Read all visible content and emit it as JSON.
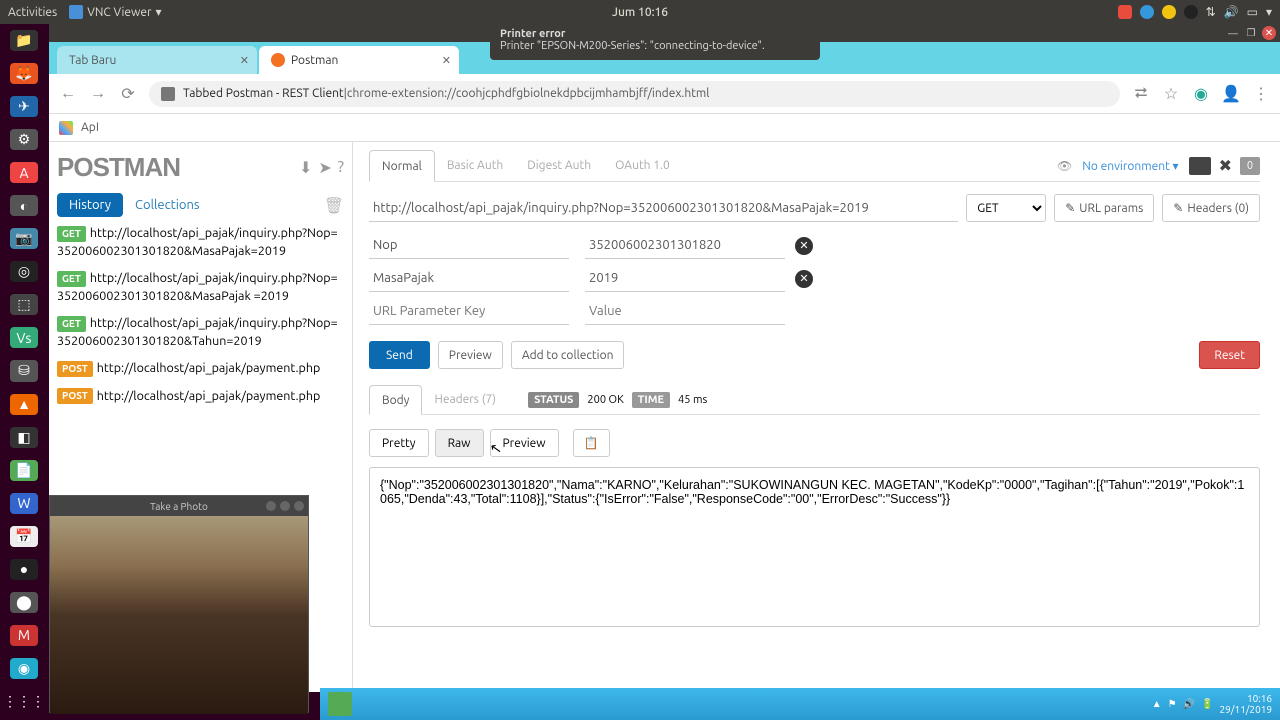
{
  "topbar": {
    "activities": "Activities",
    "app": "VNC Viewer",
    "clock": "Jum 10:16"
  },
  "notification": {
    "title": "Printer error",
    "body": "Printer \"EPSON-M200-Series\": \"connecting-to-device\"."
  },
  "browser": {
    "tabs": [
      {
        "label": "Tab Baru",
        "active": false
      },
      {
        "label": "Postman",
        "active": true
      }
    ],
    "url_prefix": "Tabbed Postman - REST Client",
    "url_sep": " | ",
    "url": "chrome-extension://coohjcphdfgbiolnekdpbcijmhambjff/index.html",
    "bookmark": "ApI"
  },
  "sidebar": {
    "logo": "POSTMAN",
    "tabs": {
      "history": "History",
      "collections": "Collections"
    },
    "history": [
      {
        "method": "GET",
        "url": "http://localhost/api_pajak/inquiry.php?Nop=352006002301301820&MasaPajak=2019"
      },
      {
        "method": "GET",
        "url": "http://localhost/api_pajak/inquiry.php?Nop=352006002301301820&MasaPajak =2019"
      },
      {
        "method": "GET",
        "url": "http://localhost/api_pajak/inquiry.php?Nop=352006002301301820&Tahun=2019"
      },
      {
        "method": "POST",
        "url": "http://localhost/api_pajak/payment.php"
      },
      {
        "method": "POST",
        "url": "http://localhost/api_pajak/payment.php"
      }
    ]
  },
  "request": {
    "auth_tabs": {
      "normal": "Normal",
      "basic": "Basic Auth",
      "digest": "Digest Auth",
      "oauth": "OAuth 1.0"
    },
    "env_label": "No environment",
    "env_badge": "0",
    "url": "http://localhost/api_pajak/inquiry.php?Nop=352006002301301820&MasaPajak=2019",
    "method": "GET",
    "url_params_btn": "URL params",
    "headers_btn": "Headers (0)",
    "params": [
      {
        "key": "Nop",
        "value": "352006002301301820"
      },
      {
        "key": "MasaPajak",
        "value": "2019"
      }
    ],
    "param_placeholder": {
      "key": "URL Parameter Key",
      "value": "Value"
    },
    "actions": {
      "send": "Send",
      "preview": "Preview",
      "add": "Add to collection",
      "reset": "Reset"
    }
  },
  "response": {
    "tabs": {
      "body": "Body",
      "headers": "Headers (7)"
    },
    "status_label": "STATUS",
    "status_value": "200 OK",
    "time_label": "TIME",
    "time_value": "45 ms",
    "view": {
      "pretty": "Pretty",
      "raw": "Raw",
      "preview": "Preview"
    },
    "body": "{\"Nop\":\"352006002301301820\",\"Nama\":\"KARNO\",\"Kelurahan\":\"SUKOWINANGUN KEC. MAGETAN\",\"KodeKp\":\"0000\",\"Tagihan\":[{\"Tahun\":\"2019\",\"Pokok\":1065,\"Denda\":43,\"Total\":1108}],\"Status\":{\"IsError\":\"False\",\"ResponseCode\":\"00\",\"ErrorDesc\":\"Success\"}}"
  },
  "webcam": {
    "title": "Take a Photo"
  },
  "taskbar": {
    "time": "10:16",
    "date": "29/11/2019"
  }
}
